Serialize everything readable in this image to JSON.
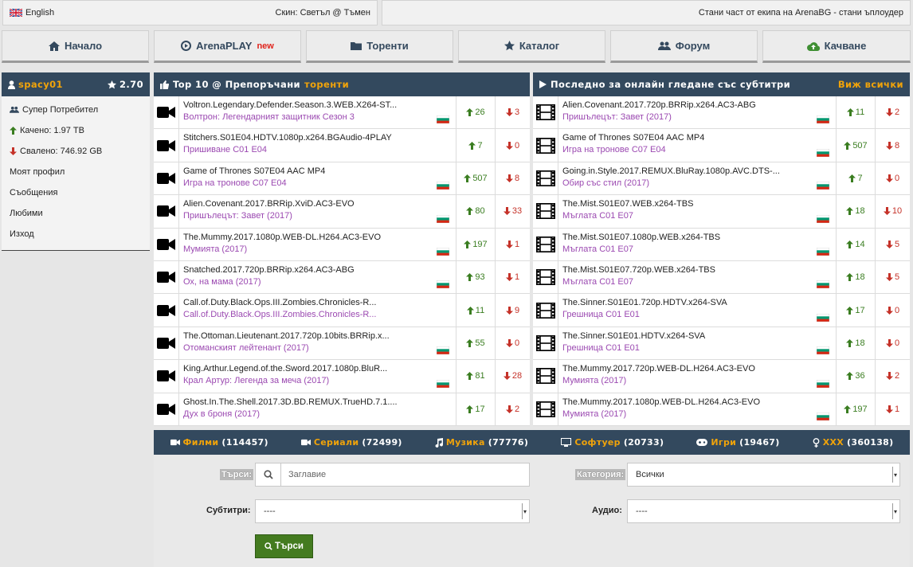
{
  "topbar": {
    "language": "English",
    "skin": "Скин: Светъл @ Тъмен",
    "uploader_cta": "Стани част от екипа на ArenaBG - стани ъплоудер"
  },
  "nav": [
    {
      "label": "Начало",
      "icon": "home-icon"
    },
    {
      "label": "ArenaPLAY",
      "badge": "new",
      "icon": "play-circle-icon"
    },
    {
      "label": "Торенти",
      "icon": "folder-icon"
    },
    {
      "label": "Каталог",
      "icon": "star-icon"
    },
    {
      "label": "Форум",
      "icon": "users-icon"
    },
    {
      "label": "Качване",
      "icon": "cloud-upload-icon"
    }
  ],
  "user": {
    "name": "spacy01",
    "rating": "2.70",
    "rank": "Супер Потребител",
    "uploaded": "Качено: 1.97 TB",
    "downloaded": "Свалено: 746.92 GB",
    "links": [
      "Моят профил",
      "Съобщения",
      "Любими",
      "Изход"
    ]
  },
  "top10": {
    "title": "Top 10 @ Препоръчани",
    "title_hl": "торенти",
    "rows": [
      {
        "name": "Voltron.Legendary.Defender.Season.3.WEB.X264-ST...",
        "sub": "Волтрон: Легендарният защитник Сезон 3",
        "seeders": "26",
        "leechers": "3",
        "flag": true
      },
      {
        "name": "Stitchers.S01E04.HDTV.1080p.x264.BGAudio-4PLAY",
        "sub": "Пришиване С01 Е04",
        "seeders": "7",
        "leechers": "0",
        "flag": false
      },
      {
        "name": "Game of Thrones S07E04 AAC MP4",
        "sub": "Игра на тронове С07 Е04",
        "seeders": "507",
        "leechers": "8",
        "flag": true
      },
      {
        "name": "Alien.Covenant.2017.BRRip.XviD.AC3-EVO",
        "sub": "Пришълецът: Завет (2017)",
        "seeders": "80",
        "leechers": "33",
        "flag": true
      },
      {
        "name": "The.Mummy.2017.1080p.WEB-DL.H264.AC3-EVO",
        "sub": "Мумията (2017)",
        "seeders": "197",
        "leechers": "1",
        "flag": true
      },
      {
        "name": "Snatched.2017.720p.BRRip.x264.AC3-ABG",
        "sub": "Ох, на мама (2017)",
        "seeders": "93",
        "leechers": "1",
        "flag": true
      },
      {
        "name": "Call.of.Duty.Black.Ops.III.Zombies.Chronicles-R...",
        "sub": "Call.of.Duty.Black.Ops.III.Zombies.Chronicles-R...",
        "seeders": "11",
        "leechers": "9",
        "flag": false
      },
      {
        "name": "The.Ottoman.Lieutenant.2017.720p.10bits.BRRip.x...",
        "sub": "Отоманският лейтенант (2017)",
        "seeders": "55",
        "leechers": "0",
        "flag": true
      },
      {
        "name": "King.Arthur.Legend.of.the.Sword.2017.1080p.BluR...",
        "sub": "Крал Артур: Легенда за меча (2017)",
        "seeders": "81",
        "leechers": "28",
        "flag": true
      },
      {
        "name": "Ghost.In.The.Shell.2017.3D.BD.REMUX.TrueHD.7.1....",
        "sub": "Дух в броня (2017)",
        "seeders": "17",
        "leechers": "2",
        "flag": false
      }
    ]
  },
  "online": {
    "title": "Последно за онлайн гледане със субтитри",
    "view_all": "Виж всички",
    "rows": [
      {
        "name": "Alien.Covenant.2017.720p.BRRip.x264.AC3-ABG",
        "sub": "Пришълецът: Завет (2017)",
        "seeders": "11",
        "leechers": "2"
      },
      {
        "name": "Game of Thrones S07E04 AAC MP4",
        "sub": "Игра на тронове С07 Е04",
        "seeders": "507",
        "leechers": "8"
      },
      {
        "name": "Going.in.Style.2017.REMUX.BluRay.1080p.AVC.DTS-...",
        "sub": "Обир със стил (2017)",
        "seeders": "7",
        "leechers": "0"
      },
      {
        "name": "The.Mist.S01E07.WEB.x264-TBS",
        "sub": "Мъглата С01 Е07",
        "seeders": "18",
        "leechers": "10"
      },
      {
        "name": "The.Mist.S01E07.1080p.WEB.x264-TBS",
        "sub": "Мъглата С01 Е07",
        "seeders": "14",
        "leechers": "5"
      },
      {
        "name": "The.Mist.S01E07.720p.WEB.x264-TBS",
        "sub": "Мъглата С01 Е07",
        "seeders": "18",
        "leechers": "5"
      },
      {
        "name": "The.Sinner.S01E01.720p.HDTV.x264-SVA",
        "sub": "Грешница С01 Е01",
        "seeders": "17",
        "leechers": "0"
      },
      {
        "name": "The.Sinner.S01E01.HDTV.x264-SVA",
        "sub": "Грешница С01 Е01",
        "seeders": "18",
        "leechers": "0"
      },
      {
        "name": "The.Mummy.2017.720p.WEB-DL.H264.AC3-EVO",
        "sub": "Мумията (2017)",
        "seeders": "36",
        "leechers": "2"
      },
      {
        "name": "The.Mummy.2017.1080p.WEB-DL.H264.AC3-EVO",
        "sub": "Мумията (2017)",
        "seeders": "197",
        "leechers": "1"
      }
    ]
  },
  "categories": [
    {
      "label": "Филми",
      "count": "(114457)",
      "icon": "video-icon"
    },
    {
      "label": "Сериали",
      "count": "(72499)",
      "icon": "video-icon"
    },
    {
      "label": "Музика",
      "count": "(77776)",
      "icon": "music-icon"
    },
    {
      "label": "Софтуер",
      "count": "(20733)",
      "icon": "monitor-icon"
    },
    {
      "label": "Игри",
      "count": "(19467)",
      "icon": "gamepad-icon"
    },
    {
      "label": "XXX",
      "count": "(360138)",
      "icon": "gender-icon"
    }
  ],
  "search": {
    "search_label": "Търси:",
    "title_placeholder": "Заглавие",
    "category_label": "Категория:",
    "category_value": "Всички",
    "subtitles_label": "Субтитри:",
    "subtitles_value": "----",
    "audio_label": "Аудио:",
    "audio_value": "----",
    "button": "Търси"
  },
  "colors": {
    "header_bg": "#33495e",
    "accent": "#f0a30a",
    "seed_green": "#3a7d20",
    "leech_red": "#c53229",
    "subtitle_purple": "#9b49b1"
  }
}
